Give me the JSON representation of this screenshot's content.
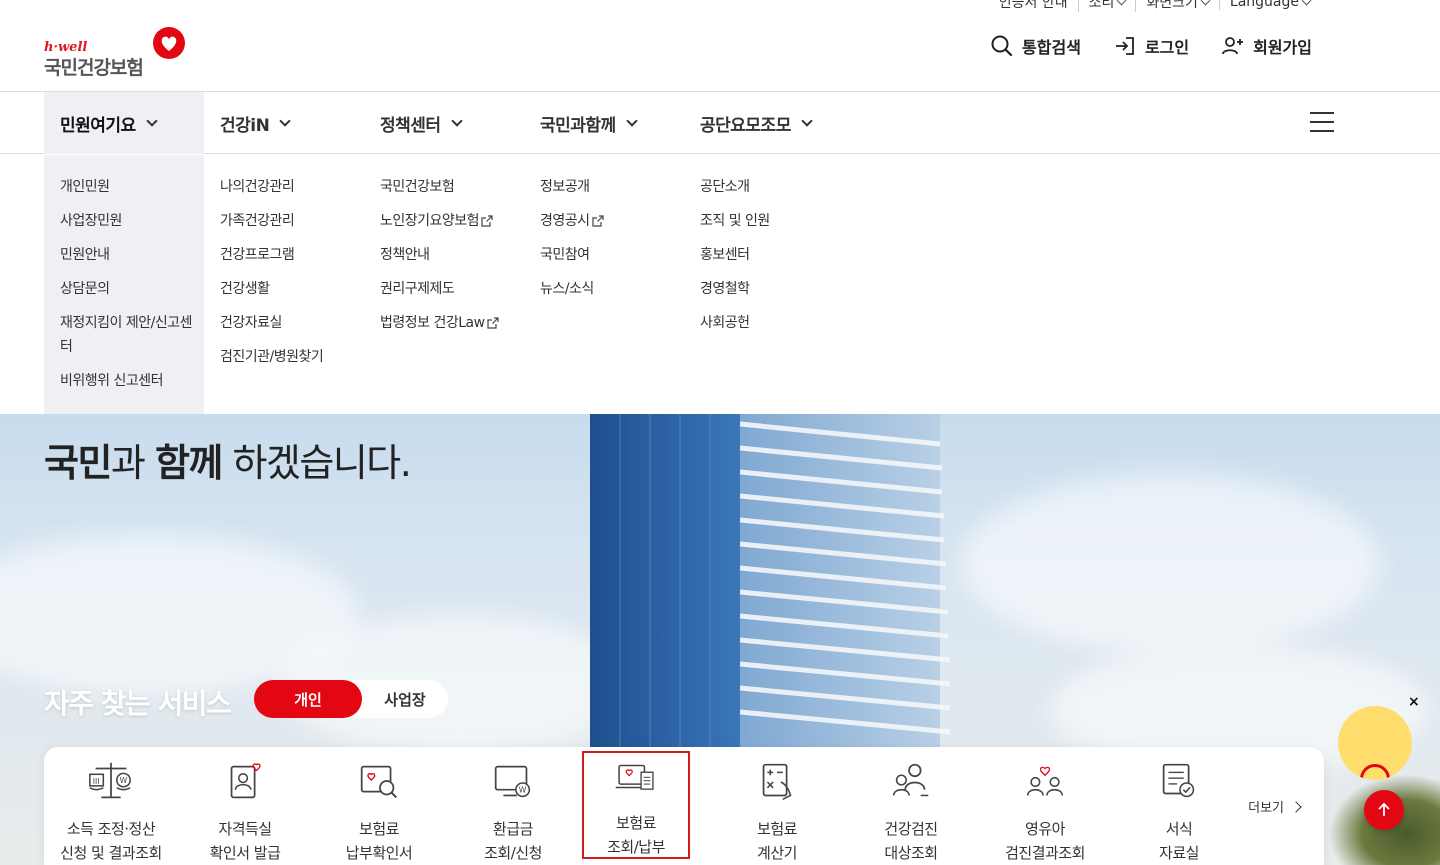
{
  "util": {
    "items": [
      "인증서 안내",
      "소리",
      "화면크기",
      "Language"
    ]
  },
  "header": {
    "logo_tag": "h·well",
    "logo_name": "국민건강보험",
    "links": {
      "search": "통합검색",
      "login": "로그인",
      "signup": "회원가입"
    }
  },
  "gnb": {
    "items": [
      "민원여기요",
      "건강iN",
      "정책센터",
      "국민과함께",
      "공단요모조모"
    ]
  },
  "mega": {
    "col1": [
      "개인민원",
      "사업장민원",
      "민원안내",
      "상담문의",
      "재정지킴이 제안/신고센터",
      "비위행위 신고센터"
    ],
    "col2": [
      "나의건강관리",
      "가족건강관리",
      "건강프로그램",
      "건강생활",
      "건강자료실",
      "검진기관/병원찾기"
    ],
    "col3": [
      "국민건강보험",
      "노인장기요양보험",
      "정책안내",
      "권리구제제도",
      "법령정보 건강Law"
    ],
    "col4": [
      "정보공개",
      "경영공시",
      "국민참여",
      "뉴스/소식"
    ],
    "col5": [
      "공단소개",
      "조직 및 인원",
      "홍보센터",
      "경영철학",
      "사회공헌"
    ]
  },
  "hero": {
    "line_bold1": "국민",
    "line_mid1": "과 ",
    "line_bold2": "함께",
    "line_rest": " 하겠습니다."
  },
  "services": {
    "title": "자주 찾는 서비스",
    "toggle_on": "개인",
    "toggle_off": "사업장",
    "more": "더보기",
    "items": [
      "소득 조정·정산\n신청 및 결과조회",
      "자격득실\n확인서 발급",
      "보험료\n납부확인서",
      "환급금\n조회/신청",
      "보험료\n조회/납부",
      "보험료\n계산기",
      "건강검진\n대상조회",
      "영유아\n검진결과조회",
      "서식\n자료실"
    ]
  },
  "floating": {
    "close": "×"
  },
  "colors": {
    "brand_red": "#e30613",
    "active_bg": "#eef0f4"
  }
}
